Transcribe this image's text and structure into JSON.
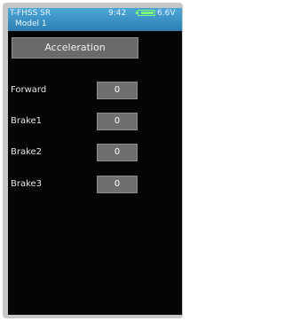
{
  "status": {
    "system": "T-FHSS SR",
    "model": "Model 1",
    "time": "9:42",
    "battery_level": 0.85,
    "voltage": "6.6V"
  },
  "screen_title": "Acceleration",
  "rows": [
    {
      "label": "Forward",
      "value": "0"
    },
    {
      "label": "Brake1",
      "value": "0"
    },
    {
      "label": "Brake2",
      "value": "0"
    },
    {
      "label": "Brake3",
      "value": "0"
    }
  ]
}
